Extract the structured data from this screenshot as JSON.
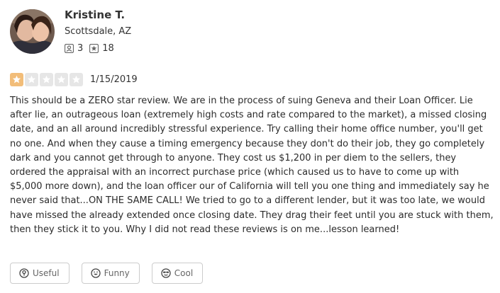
{
  "reviewer": {
    "name": "Kristine T.",
    "location": "Scottsdale, AZ",
    "friends_count": "3",
    "reviews_count": "18",
    "avatar_icon": "avatar-photo"
  },
  "review": {
    "rating": 1,
    "rating_max": 5,
    "date": "1/15/2019",
    "text": "This should be a ZERO star review. We are in the process of suing Geneva and their Loan Officer. Lie after lie, an outrageous loan (extremely high costs and rate compared to the market), a missed closing date, and an all around incredibly stressful experience. Try calling their home office number, you'll get no one. And when they cause a timing emergency because they don't do their job, they go completely dark and you cannot get through to anyone. They cost us $1,200 in per diem to the sellers, they ordered the appraisal with an incorrect purchase price (which caused us to have to come up with $5,000 more down),  and the loan officer our of California will tell you one thing and immediately say he never said that...ON THE SAME CALL! We tried to go to a different lender, but it was too late, we would have missed the already extended once closing date. They drag their feet until you are stuck with them, then they stick it to you. Why I did not read these reviews is on me...lesson learned!"
  },
  "actions": {
    "useful_label": "Useful",
    "funny_label": "Funny",
    "cool_label": "Cool"
  },
  "colors": {
    "star_active": "#f2bd79",
    "star_inactive": "#e6e6e6",
    "text": "#2b2b2b",
    "button_border": "#cccccc"
  }
}
